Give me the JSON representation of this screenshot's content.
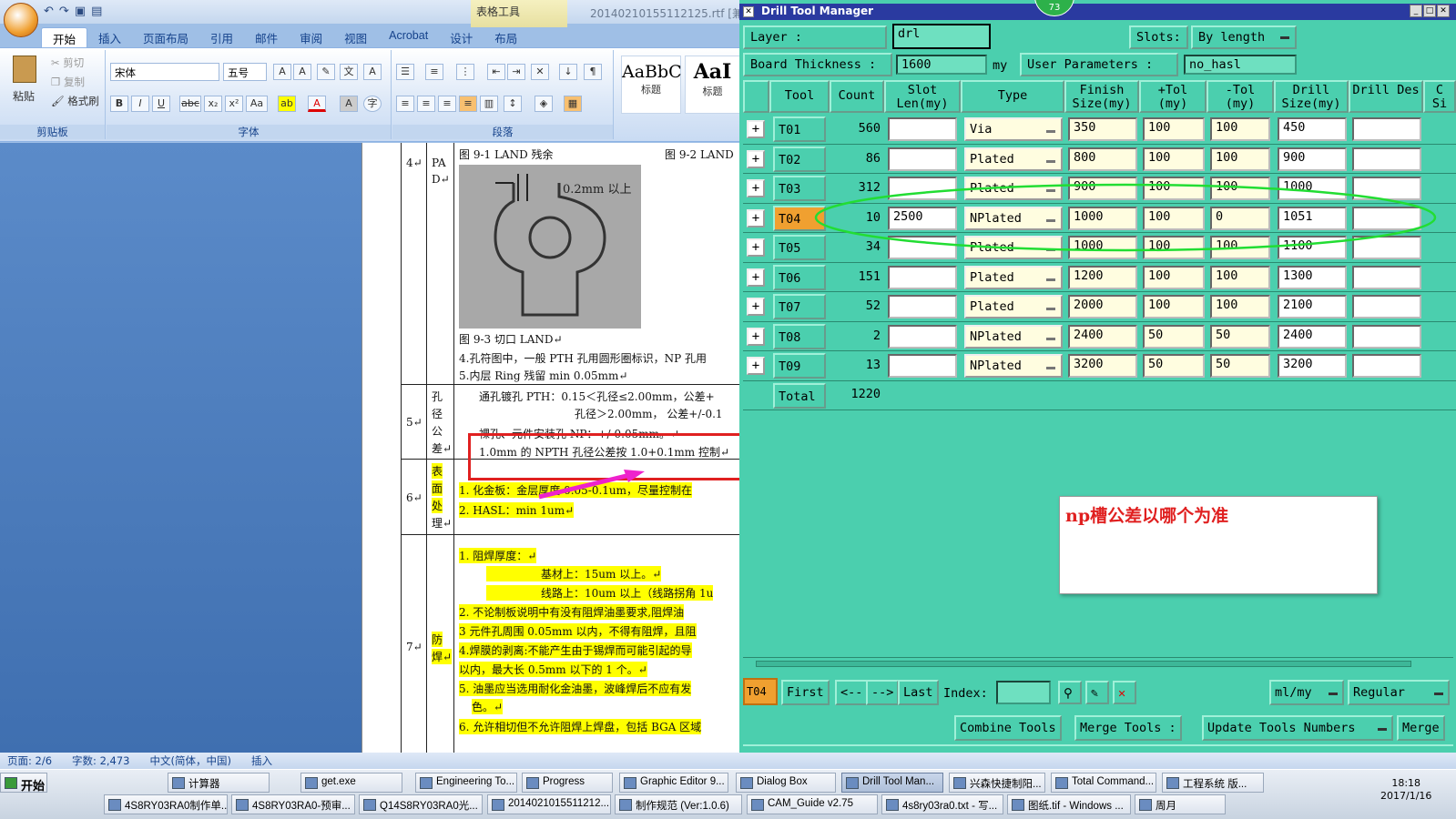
{
  "word": {
    "qat_icons": [
      "undo-icon",
      "redo-icon",
      "save-icon",
      "open-icon"
    ],
    "doc_title": "20140210155112125.rtf [兼容",
    "table_tools": "表格工具",
    "tabs": [
      "开始",
      "插入",
      "页面布局",
      "引用",
      "邮件",
      "审阅",
      "视图",
      "Acrobat",
      "设计",
      "布局"
    ],
    "clipboard": {
      "paste": "粘贴",
      "cut": "剪切",
      "copy": "复制",
      "format_painter": "格式刷",
      "label": "剪贴板"
    },
    "font": {
      "name": "宋体",
      "size": "五号",
      "label": "字体",
      "btns": [
        "B",
        "I",
        "U",
        "abc",
        "x₂",
        "x²",
        "Aa",
        "A"
      ]
    },
    "paragraph": {
      "label": "段落"
    },
    "styles": [
      {
        "sample": "AaBbC",
        "name": "标题"
      },
      {
        "sample": "AaI",
        "name": "标题"
      }
    ],
    "doc": {
      "row4_num": "4↵",
      "row4_label": [
        "PA",
        "D↵"
      ],
      "fig1": "图 9-1 LAND 残余",
      "fig2": "图 9-2 LAND",
      "fig_annot": "0.2mm 以上",
      "fig3": "图 9-3 切口 LAND↵",
      "line4": "4.孔符图中，一般 PTH 孔用圆形圈标识，NP 孔用",
      "line5": "5.内层 Ring 残留 min 0.05mm↵",
      "row5_num": "5↵",
      "row5_label": [
        "孔",
        "径",
        "公",
        "差↵"
      ],
      "r5_l1": "通孔镀孔 PTH：0.15＜孔径≤2.00mm，公差+",
      "r5_l2": "孔径＞2.00mm， 公差+/-0.1",
      "r5_l3": "裸孔、元件安装孔 NP：+/-0.05mm。↵",
      "r5_l4": "1.0mm 的 NPTH 孔径公差按 1.0+0.1mm 控制↵",
      "row6_num": "6↵",
      "row6_label": [
        "表",
        "面",
        "处",
        "理↵"
      ],
      "r6_l1": "1.  化金板：金层厚度 0.05-0.1um，尽量控制在",
      "r6_l2": "2.  HASL：min 1um↵",
      "row7_num": "7↵",
      "row7_label": [
        "防",
        "焊↵"
      ],
      "r7_l1": "1.  阻焊厚度：↵",
      "r7_l2": "基材上：15um 以上。↵",
      "r7_l3": "线路上：10um 以上（线路拐角 1u",
      "r7_l4": "2. 不论制板说明中有没有阻焊油墨要求,阻焊油",
      "r7_l5": "3  元件孔周围 0.05mm 以内，不得有阻焊，且阻",
      "r7_l6": "4.焊膜的剥离:不能产生由于锡焊而可能引起的导",
      "r7_l7": "以内，最大长 0.5mm 以下的 1 个。↵",
      "r7_l8": "5. 油墨应当选用耐化金油墨，波峰焊后不应有发",
      "r7_l9": "色。↵",
      "r7_l10": "6. 允许相切但不允许阻焊上焊盘，包括 BGA 区域"
    },
    "status": {
      "page": "页面: 2/6",
      "words": "字数: 2,473",
      "lang": "中文(简体，中国)",
      "mode": "插入"
    }
  },
  "dtm": {
    "title": "Drill Tool Manager",
    "badge": "73",
    "layer_label": "Layer          :",
    "layer_value": "drl",
    "slots_label": "Slots:",
    "slots_value": "By length",
    "board_label": "Board Thickness  :",
    "board_value": "1600",
    "board_unit": "my",
    "user_params_label": "User Parameters  :",
    "user_params_value": "no_hasl",
    "headers": [
      "Tool",
      "Count",
      "Slot Len(my)",
      "Type",
      "Finish Size(my)",
      "+Tol (my)",
      "-Tol (my)",
      "Drill Size(my)",
      "Drill Des",
      "C Si"
    ],
    "rows": [
      {
        "tool": "T01",
        "count": "560",
        "slot": "",
        "type": "Via",
        "finish": "350",
        "ptol": "100",
        "mtol": "100",
        "drill": "450",
        "des": ""
      },
      {
        "tool": "T02",
        "count": "86",
        "slot": "",
        "type": "Plated",
        "finish": "800",
        "ptol": "100",
        "mtol": "100",
        "drill": "900",
        "des": ""
      },
      {
        "tool": "T03",
        "count": "312",
        "slot": "",
        "type": "Plated",
        "finish": "900",
        "ptol": "100",
        "mtol": "100",
        "drill": "1000",
        "des": ""
      },
      {
        "tool": "T04",
        "count": "10",
        "slot": "2500",
        "type": "NPlated",
        "finish": "1000",
        "ptol": "100",
        "mtol": "0",
        "drill": "1051",
        "des": ""
      },
      {
        "tool": "T05",
        "count": "34",
        "slot": "",
        "type": "Plated",
        "finish": "1000",
        "ptol": "100",
        "mtol": "100",
        "drill": "1100",
        "des": ""
      },
      {
        "tool": "T06",
        "count": "151",
        "slot": "",
        "type": "Plated",
        "finish": "1200",
        "ptol": "100",
        "mtol": "100",
        "drill": "1300",
        "des": ""
      },
      {
        "tool": "T07",
        "count": "52",
        "slot": "",
        "type": "Plated",
        "finish": "2000",
        "ptol": "100",
        "mtol": "100",
        "drill": "2100",
        "des": ""
      },
      {
        "tool": "T08",
        "count": "2",
        "slot": "",
        "type": "NPlated",
        "finish": "2400",
        "ptol": "50",
        "mtol": "50",
        "drill": "2400",
        "des": ""
      },
      {
        "tool": "T09",
        "count": "13",
        "slot": "",
        "type": "NPlated",
        "finish": "3200",
        "ptol": "50",
        "mtol": "50",
        "drill": "3200",
        "des": ""
      }
    ],
    "total_label": "Total",
    "total_count": "1220",
    "selected_tool": "T04",
    "nav": {
      "first": "First",
      "prev": "<--",
      "next": "-->",
      "last": "Last",
      "index": "Index:",
      "units": "ml/my",
      "mode": "Regular"
    },
    "actions": {
      "combine": "Combine Tools",
      "merge_label": "Merge Tools  :",
      "update": "Update Tools Numbers",
      "merge": "Merge"
    },
    "note": "np槽公差以哪个为准",
    "colors": {
      "bg": "#4bcfae",
      "title": "#2a3aa0",
      "highlight_ellipse": "#22dd33",
      "annotation_box": "#e02020",
      "arrow": "#ee22cc"
    }
  },
  "taskbar": {
    "start": "开始",
    "row1": [
      "计算器",
      "get.exe",
      "Engineering To...",
      "Progress",
      "Graphic Editor 9...",
      "Dialog Box",
      "Drill Tool Man...",
      "兴森快捷制阳...",
      "Total Command...",
      "工程系统  版..."
    ],
    "row2": [
      "4S8RY03RA0制作单...",
      "4S8RY03RA0-预审...",
      "Q14S8RY03RA0光...",
      "2014021015511212...",
      "制作规范 (Ver:1.0.6)",
      "CAM_Guide v2.75",
      "4s8ry03ra0.txt - 写...",
      "图纸.tif - Windows ...",
      "周月"
    ],
    "time": "18:18",
    "date": "2017/1/16"
  }
}
